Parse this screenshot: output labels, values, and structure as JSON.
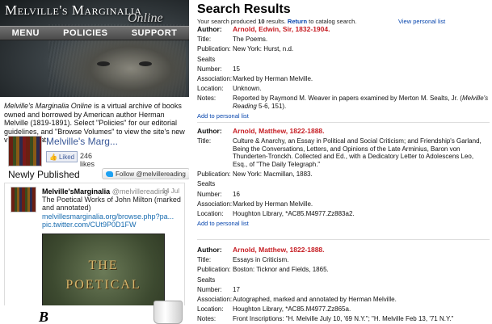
{
  "site": {
    "logo_main": "Melville's Marginalia",
    "logo_sub": "Online",
    "nav": [
      "MENU",
      "POLICIES",
      "SUPPORT"
    ]
  },
  "intro": {
    "title": "Melville's Marginalia Online",
    "text": " is a virtual archive of books owned and borrowed by American author Herman Melville (1819-1891). Select \"Policies\" for our editorial guidelines, and \"Browse Volumes\" to view the site's new virtual format."
  },
  "facebook": {
    "page_name": "Melville's Marg...",
    "like_label": "Liked",
    "likes": "246 likes"
  },
  "newly_published": {
    "heading": "Newly Published",
    "follow_label": "Follow @melvillereading"
  },
  "tweet": {
    "name": "Melville'sMarginalia",
    "handle": "@melvillereading",
    "date": "14 Jul",
    "text": "The Poetical Works of John Milton (marked and annotated)",
    "link1": "melvillesmarginalia.org/browse.php?pa...",
    "link2": "pic.twitter.com/CUt9P0D1FW",
    "image_line1": "THE",
    "image_line2": "POETICAL"
  },
  "bottom": {
    "logo_letter": "B"
  },
  "results": {
    "heading": "Search Results",
    "summary_prefix": "Your search produced ",
    "summary_count": "10",
    "summary_suffix": " results.",
    "return_link": "Return",
    "return_suffix": " to catalog search.",
    "view_personal": "View personal list",
    "add_link": "Add to personal list",
    "labels": {
      "author": "Author:",
      "title": "Title:",
      "publication": "Publication:",
      "seal1": "Sealts",
      "seal2": "Number:",
      "association": "Association:",
      "location": "Location:",
      "notes": "Notes:"
    },
    "records": [
      {
        "author": "Arnold, Edwin, Sir, 1832-1904.",
        "title": "The Poems.",
        "publication": "New York: Hurst, n.d.",
        "sealts": "15",
        "association": "Marked by Herman Melville.",
        "location": "Unknown.",
        "notes_a": "Reported by Raymond M. Weaver in papers examined by Merton M. Sealts, Jr. (",
        "notes_i": "Melville's Reading",
        "notes_b": " 5-6, 151)."
      },
      {
        "author": "Arnold, Matthew, 1822-1888.",
        "title": "Culture & Anarchy, an Essay in Political and Social Criticism; and Friendship's Garland, Being the Conversations, Letters, and Opinions of the Late Arminius, Baron von Thunderten-Tronckh. Collected and Ed., with a Dedicatory Letter to Adolescens Leo, Esq., of \"The Daily Telegraph.\"",
        "publication": "New York: Macmillan, 1883.",
        "sealts": "16",
        "association": "Marked by Herman Melville.",
        "location": "Houghton Library, *AC85.M4977.Zz883a2."
      },
      {
        "author": "Arnold, Matthew, 1822-1888.",
        "title": "Essays in Criticism.",
        "publication": "Boston: Ticknor and Fields, 1865.",
        "sealts": "17",
        "association": "Autographed, marked and annotated by Herman Melville.",
        "location": "Houghton Library, *AC85.M4977.Zz865a.",
        "notes_a": "Front Inscriptions: \"H. Melville July 10, '69 N.Y.\"; \"H. Melville Feb 13, '71 N.Y.\""
      }
    ]
  },
  "colors": {
    "author_red": "#c61d23",
    "link_blue": "#0645ad",
    "twitter_blue": "#1da1f2",
    "facebook_blue": "#3b5998"
  }
}
